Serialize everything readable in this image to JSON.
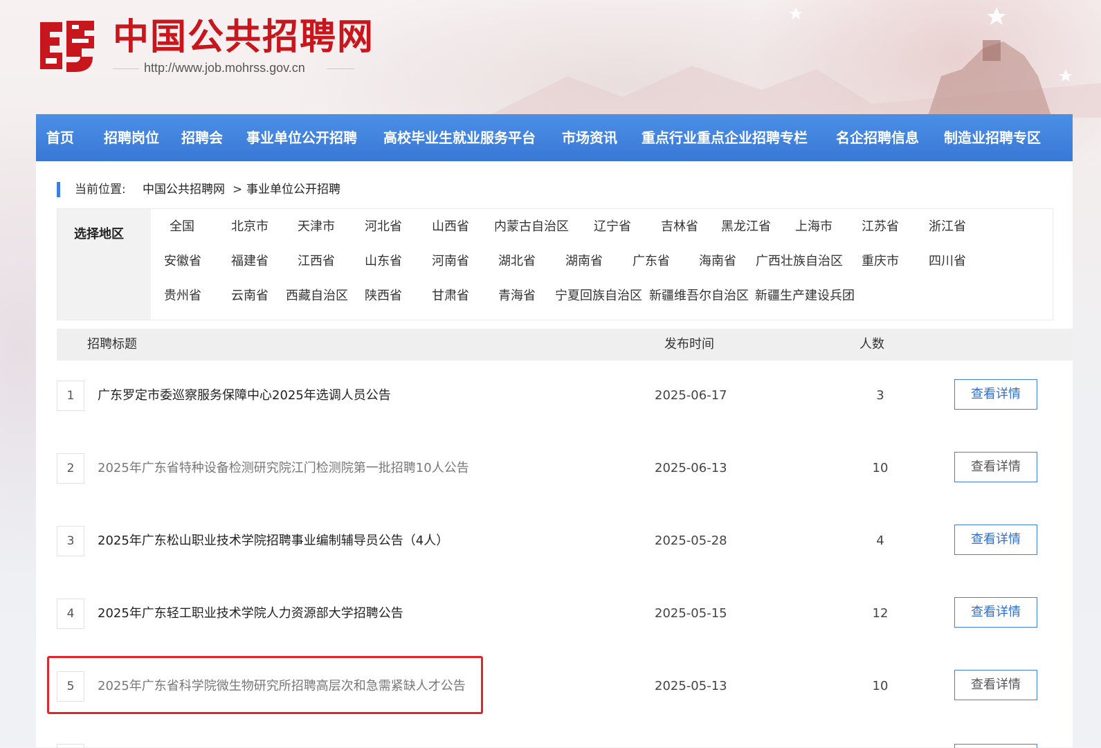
{
  "header": {
    "site_name": "中国公共招聘网",
    "site_url": "http://www.job.mohrss.gov.cn"
  },
  "nav": {
    "items": [
      "首页",
      "招聘岗位",
      "招聘会",
      "事业单位公开招聘",
      "高校毕业生就业服务平台",
      "市场资讯",
      "重点行业重点企业招聘专栏",
      "名企招聘信息",
      "制造业招聘专区"
    ]
  },
  "breadcrumb": {
    "label": "当前位置:",
    "home": "中国公共招聘网",
    "separator": ">",
    "current": "事业单位公开招聘"
  },
  "region_filter": {
    "label": "选择地区",
    "regions": [
      "全国",
      "北京市",
      "天津市",
      "河北省",
      "山西省",
      "内蒙古自治区",
      "辽宁省",
      "吉林省",
      "黑龙江省",
      "上海市",
      "江苏省",
      "浙江省",
      "安徽省",
      "福建省",
      "江西省",
      "山东省",
      "河南省",
      "湖北省",
      "湖南省",
      "广东省",
      "海南省",
      "广西壮族自治区",
      "重庆市",
      "四川省",
      "贵州省",
      "云南省",
      "西藏自治区",
      "陕西省",
      "甘肃省",
      "青海省",
      "宁夏回族自治区",
      "新疆维吾尔自治区",
      "新疆生产建设兵团"
    ]
  },
  "table": {
    "headers": {
      "title": "招聘标题",
      "date": "发布时间",
      "count": "人数"
    },
    "button_label": "查看详情",
    "rows": [
      {
        "index": "1",
        "title": "广东罗定市委巡察服务保障中心2025年选调人员公告",
        "date": "2025-06-17",
        "count": "3"
      },
      {
        "index": "2",
        "title": "2025年广东省特种设备检测研究院江门检测院第一批招聘10人公告",
        "date": "2025-06-13",
        "count": "10"
      },
      {
        "index": "3",
        "title": "2025年广东松山职业技术学院招聘事业编制辅导员公告（4人）",
        "date": "2025-05-28",
        "count": "4"
      },
      {
        "index": "4",
        "title": "2025年广东轻工职业技术学院人力资源部大学招聘公告",
        "date": "2025-05-15",
        "count": "12"
      },
      {
        "index": "5",
        "title": "2025年广东省科学院微生物研究所招聘高层次和急需紧缺人才公告",
        "date": "2025-05-13",
        "count": "10"
      }
    ]
  },
  "colors": {
    "brand_red": "#c8161d",
    "nav_blue": "#3d7fd9",
    "highlight_red": "#e0262b"
  }
}
